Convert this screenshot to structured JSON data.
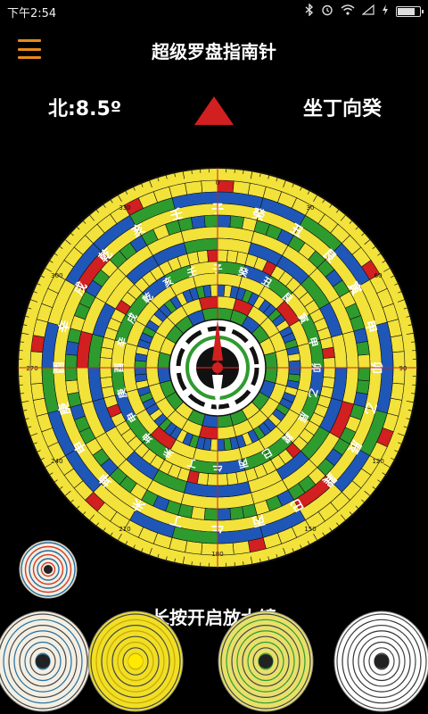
{
  "status_bar": {
    "time": "下午2:54",
    "battery_level": 0.88
  },
  "app_bar": {
    "title": "超级罗盘指南针"
  },
  "readout": {
    "heading": "北:8.5º",
    "direction": "坐丁向癸"
  },
  "compass": {
    "degree_labels": [
      "0",
      "30",
      "60",
      "90",
      "120",
      "150",
      "180",
      "210",
      "240",
      "270",
      "300",
      "330"
    ],
    "mountains": [
      "子",
      "癸",
      "丑",
      "艮",
      "寅",
      "甲",
      "卯",
      "乙",
      "辰",
      "巽",
      "巳",
      "丙",
      "午",
      "丁",
      "未",
      "坤",
      "申",
      "庚",
      "酉",
      "辛",
      "戌",
      "乾",
      "亥",
      "壬"
    ],
    "colors": {
      "yellow": "#f2e23a",
      "blue": "#1f57b8",
      "green": "#2e9b2e",
      "red": "#d21f1f",
      "black": "#111111"
    }
  },
  "hint": {
    "text": "长按开启放大镜"
  },
  "themes": [
    {
      "name": "theme-classic-white",
      "bg": "#f4efe2",
      "accent": "#1f6fa3"
    },
    {
      "name": "theme-golden",
      "bg": "#f0df25",
      "accent": "#c9a800"
    },
    {
      "name": "theme-colorful",
      "bg": "#e8e06a",
      "accent": "#2e9b2e"
    },
    {
      "name": "theme-bagua-white",
      "bg": "#ffffff",
      "accent": "#333333"
    }
  ]
}
